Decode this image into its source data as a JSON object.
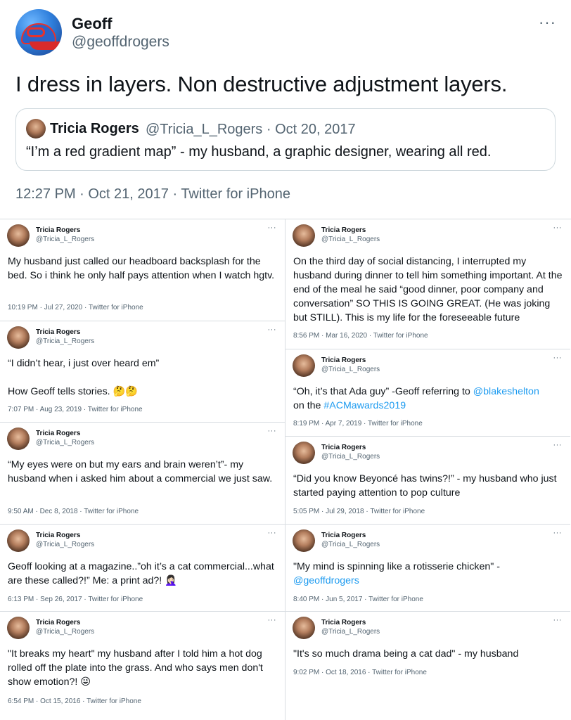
{
  "main": {
    "name": "Geoff",
    "handle": "@geoffdrogers",
    "more_icon": "more-horizontal-icon",
    "text": "I dress in layers. Non destructive adjustment layers.",
    "quote": {
      "name": "Tricia Rogers",
      "meta": "@Tricia_L_Rogers · Oct 20, 2017",
      "text": "“I’m a red gradient map” - my husband, a graphic designer, wearing all red."
    },
    "meta": "12:27 PM · Oct 21, 2017 · Twitter for iPhone"
  },
  "left_column": [
    {
      "name": "Tricia Rogers",
      "handle": "@Tricia_L_Rogers",
      "text": "My husband just called our headboard backsplash for the bed. So i think he only half pays attention when I watch hgtv.",
      "meta": "10:19 PM · Jul 27, 2020 · Twitter for iPhone"
    },
    {
      "name": "Tricia Rogers",
      "handle": "@Tricia_L_Rogers",
      "text": "“I didn’t hear, i just over heard em”\n\nHow Geoff tells stories. 🤔🤔",
      "meta": "7:07 PM · Aug 23, 2019 · Twitter for iPhone"
    },
    {
      "name": "Tricia Rogers",
      "handle": "@Tricia_L_Rogers",
      "text": "“My eyes were on but my ears and brain weren’t”- my husband when i asked him about a commercial we just saw.",
      "meta": "9:50 AM · Dec 8, 2018 · Twitter for iPhone"
    },
    {
      "name": "Tricia Rogers",
      "handle": "@Tricia_L_Rogers",
      "text": "Geoff looking at a magazine..”oh it’s a cat commercial...what are these called?!” Me: a print ad?! 🤦🏻‍♀️",
      "meta": "6:13 PM · Sep 26, 2017 · Twitter for iPhone"
    },
    {
      "name": "Tricia Rogers",
      "handle": "@Tricia_L_Rogers",
      "text": "\"It breaks my heart\" my husband after I told him a hot dog rolled off the plate into the grass. And who says men don't show emotion?! 😜",
      "meta": "6:54 PM · Oct 15, 2016 · Twitter for iPhone"
    }
  ],
  "right_column": [
    {
      "name": "Tricia Rogers",
      "handle": "@Tricia_L_Rogers",
      "text": "On the third day of social distancing, I interrupted my husband during dinner to tell him something important. At the end of the meal he said “good dinner, poor company and conversation” SO THIS IS GOING GREAT. (He was joking but STILL). This is my life for the foreseeable future",
      "meta": "8:56 PM · Mar 16, 2020 · Twitter for iPhone"
    },
    {
      "name": "Tricia Rogers",
      "handle": "@Tricia_L_Rogers",
      "text_pre": "“Oh, it’s that Ada guy” -Geoff referring to ",
      "mention": "@blakeshelton",
      "text_mid": "on the ",
      "hashtag": "#ACMawards2019",
      "meta": "8:19 PM · Apr 7, 2019 · Twitter for iPhone"
    },
    {
      "name": "Tricia Rogers",
      "handle": "@Tricia_L_Rogers",
      "text": "“Did you know Beyoncé has twins?!” - my husband who just started paying attention to pop culture",
      "meta": "5:05 PM · Jul 29, 2018 · Twitter for iPhone"
    },
    {
      "name": "Tricia Rogers",
      "handle": "@Tricia_L_Rogers",
      "text_pre": "\"My mind is spinning like a rotisserie chicken\" -",
      "mention": "@geoffdrogers",
      "meta": "8:40 PM · Jun 5, 2017 · Twitter for iPhone"
    },
    {
      "name": "Tricia Rogers",
      "handle": "@Tricia_L_Rogers",
      "text": "\"It's so much drama being a cat dad\" - my husband",
      "meta": "9:02 PM · Oct 18, 2016 · Twitter for iPhone"
    }
  ],
  "more_glyph": "···",
  "colors": {
    "link": "#1d9bf0",
    "secondary_text": "#536471",
    "border": "#cfd9de"
  }
}
